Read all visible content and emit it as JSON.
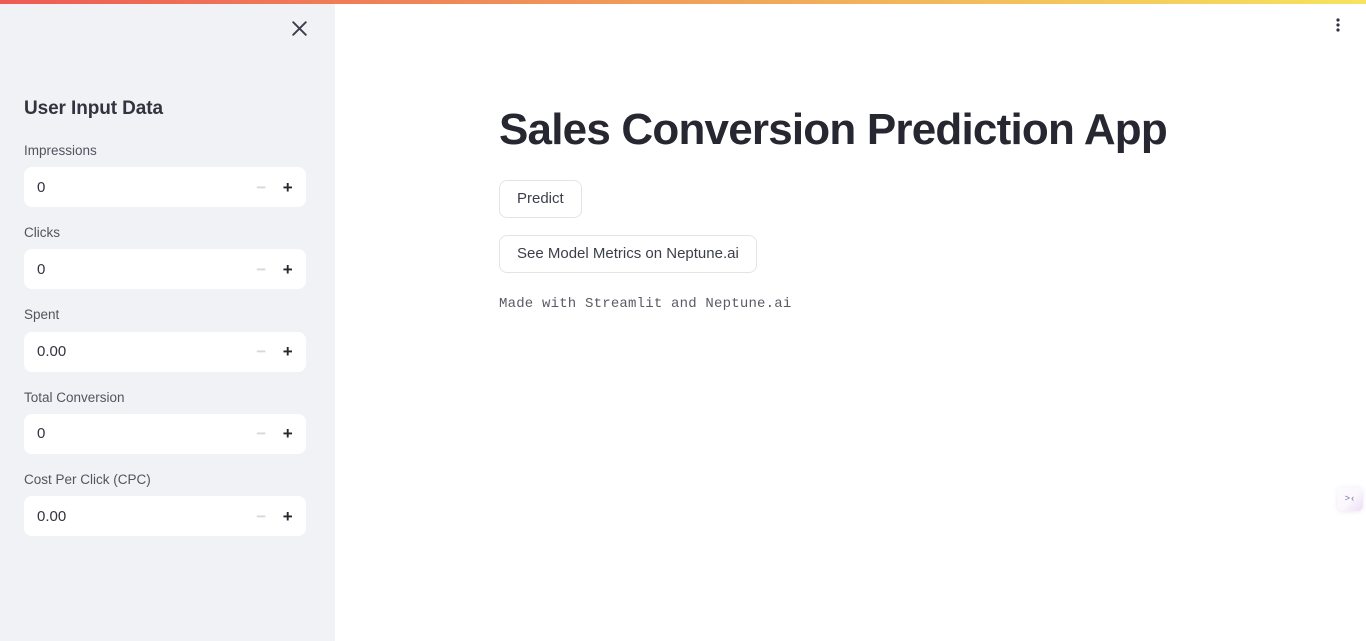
{
  "theme": {
    "gradient_start": "#ee5b56",
    "gradient_mid": "#f0a05a",
    "gradient_end": "#f6e35e",
    "sidebar_bg": "#f0f2f6",
    "main_bg": "#ffffff",
    "text_primary": "#262730",
    "text_secondary": "#52555e",
    "border": "#e3e4e8"
  },
  "sidebar": {
    "title": "User Input Data",
    "close_label": "×",
    "fields": [
      {
        "label": "Impressions",
        "value": "0",
        "minus": "−",
        "plus": "+"
      },
      {
        "label": "Clicks",
        "value": "0",
        "minus": "−",
        "plus": "+"
      },
      {
        "label": "Spent",
        "value": "0.00",
        "minus": "−",
        "plus": "+"
      },
      {
        "label": "Total Conversion",
        "value": "0",
        "minus": "−",
        "plus": "+"
      },
      {
        "label": "Cost Per Click (CPC)",
        "value": "0.00",
        "minus": "−",
        "plus": "+"
      }
    ]
  },
  "main": {
    "title": "Sales Conversion Prediction App",
    "predict_button": "Predict",
    "metrics_button": "See Model Metrics on Neptune.ai",
    "footer": "Made with Streamlit and Neptune.ai",
    "menu_icon": "kebab-menu-icon"
  },
  "widget": {
    "glyph": ">‹"
  }
}
